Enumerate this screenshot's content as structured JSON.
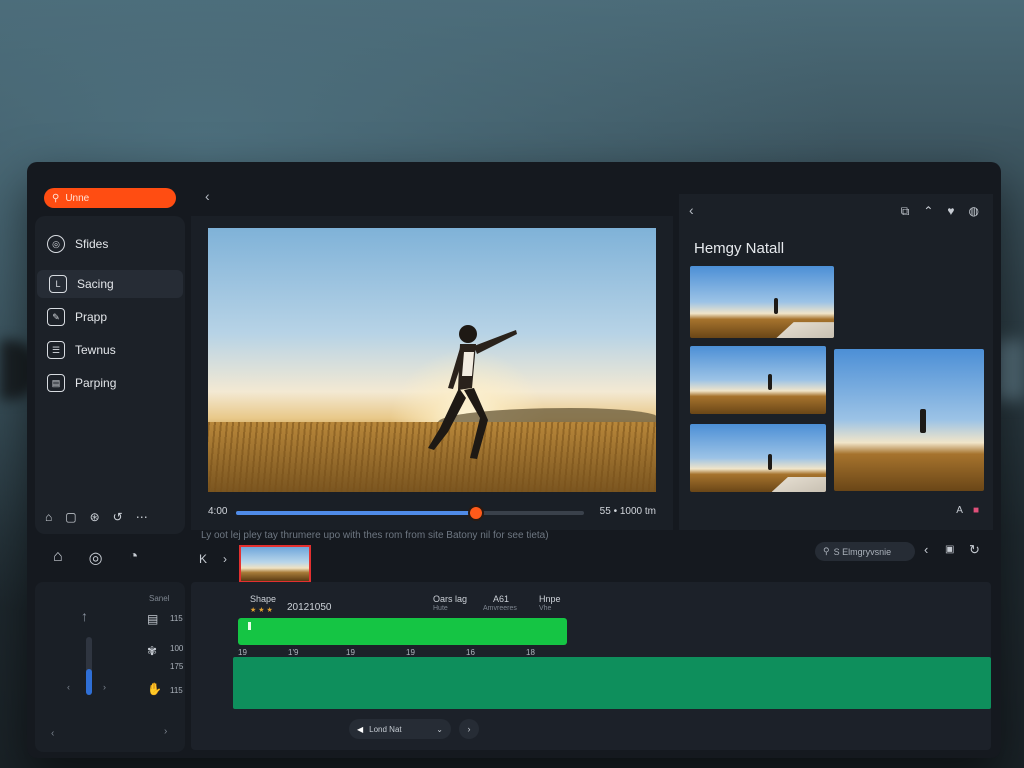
{
  "sidebar": {
    "search_label": "Unne",
    "items": [
      {
        "label": "Sfides",
        "icon": "user-icon"
      },
      {
        "label": "Sacing",
        "icon": "frame-icon"
      },
      {
        "label": "Prapp",
        "icon": "edit-icon"
      },
      {
        "label": "Tewnus",
        "icon": "list-icon"
      },
      {
        "label": "Parping",
        "icon": "document-icon"
      }
    ],
    "bottom_icons": [
      "home-icon",
      "folder-icon",
      "settings-icon",
      "undo-icon",
      "more-icon"
    ]
  },
  "preview": {
    "time_start": "4:00",
    "time_end": "55 • 1000 tm",
    "progress": 0.69
  },
  "right_panel": {
    "title": "Hemgy Natall",
    "header_icons": [
      "copy-icon",
      "chevron-up-icon",
      "heart-icon",
      "globe-icon"
    ],
    "footer_icons": [
      "text-icon",
      "flag-icon"
    ]
  },
  "caption": "Ly oot lej pley tay thrumere upo with thes rom from site Batony nil for see tieta)",
  "clip_search": {
    "placeholder": "S Elmgryvsnie"
  },
  "timeline": {
    "track_name": "Shape",
    "timecode": "20121050",
    "col1_label": "Oars lag",
    "col1_sub": "Hute",
    "col2_label": "A61",
    "col2_sub": "Amvreeres",
    "col3_label": "Hnpe",
    "col3_sub": "Vhe",
    "ruler_marks": [
      "19",
      "1'9",
      "19",
      "19",
      "16",
      "18"
    ],
    "dropdown_label": "Lond Nat"
  },
  "left_tools": {
    "scale_label": "Sanel",
    "values": [
      "115",
      "100",
      "175",
      "115"
    ],
    "slider_level": 0.45
  },
  "colors": {
    "accent": "#ff4d12",
    "timeline_green": "#15c544",
    "track_green": "#0e8f5c",
    "progress_blue": "#4f8be8"
  }
}
